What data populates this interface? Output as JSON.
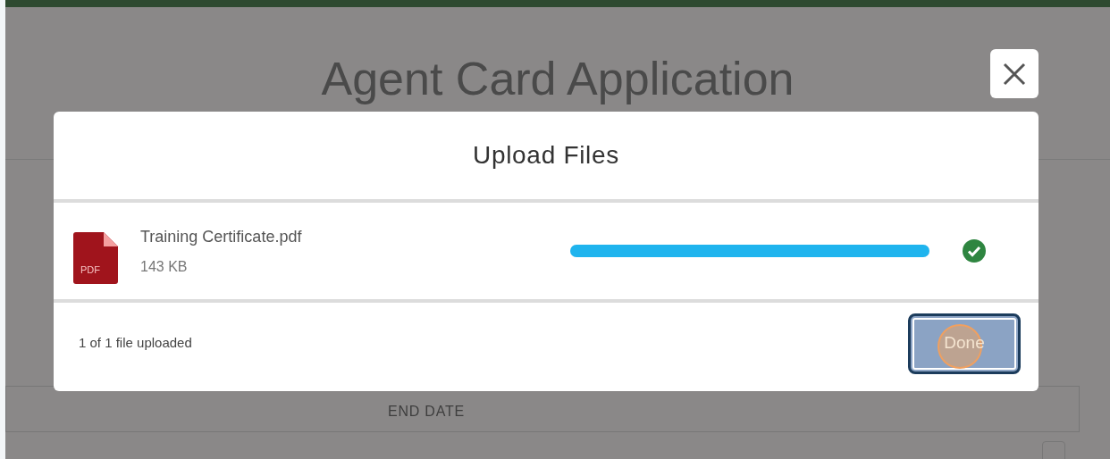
{
  "page": {
    "title": "Agent Card Application",
    "table_header": "END DATE"
  },
  "dialog": {
    "title": "Upload Files",
    "files": [
      {
        "name": "Training Certificate.pdf",
        "size": "143 KB",
        "type_label": "PDF",
        "level": 1,
        "complete": true
      }
    ],
    "status": "1 of 1 file uploaded",
    "done_button": {
      "label": "Done",
      "highlighted": true
    }
  }
}
